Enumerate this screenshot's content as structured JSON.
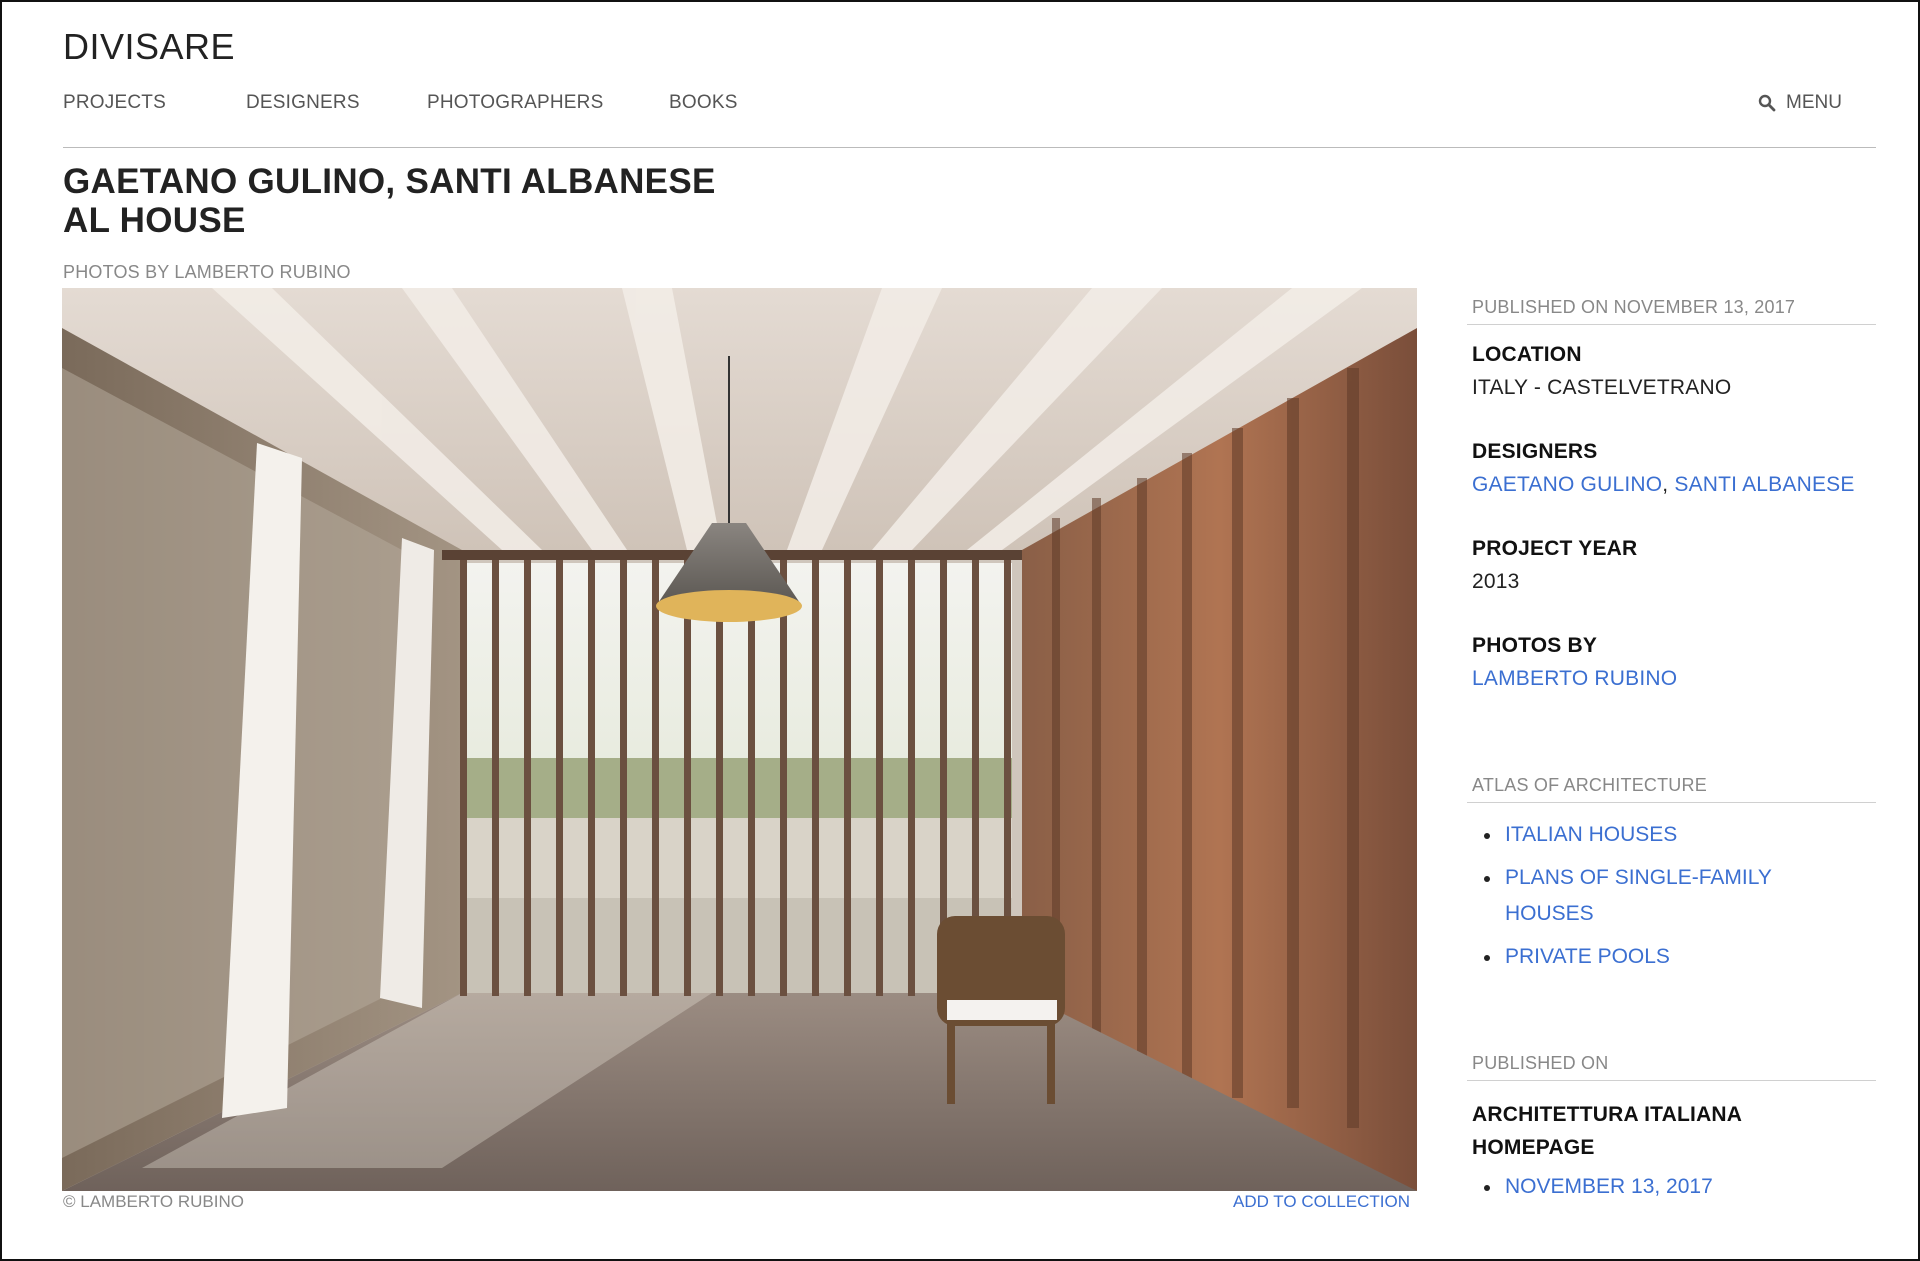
{
  "site": {
    "logo": "DIVISARE"
  },
  "nav": {
    "items": [
      "PROJECTS",
      "DESIGNERS",
      "PHOTOGRAPHERS",
      "BOOKS"
    ],
    "menu_label": "MENU"
  },
  "project": {
    "title_line1": "GAETANO GULINO, SANTI ALBANESE",
    "title_line2": "AL HOUSE",
    "photos_by_label": "PHOTOS BY LAMBERTO RUBINO"
  },
  "image": {
    "alt": "Interior of a room with wooden louvered walls, pendant lamp and wicker chair",
    "credit": "© LAMBERTO RUBINO",
    "add_to_collection": "ADD TO COLLECTION"
  },
  "sidebar": {
    "published_on": "PUBLISHED ON NOVEMBER 13, 2017",
    "location_label": "LOCATION",
    "location_value": "ITALY - CASTELVETRANO",
    "designers_label": "DESIGNERS",
    "designers": [
      "GAETANO GULINO",
      "SANTI ALBANESE"
    ],
    "designers_sep": ", ",
    "year_label": "PROJECT YEAR",
    "year_value": "2013",
    "photos_label": "PHOTOS BY",
    "photographer": "LAMBERTO RUBINO",
    "atlas_heading": "ATLAS OF ARCHITECTURE",
    "atlas_items": [
      "ITALIAN HOUSES",
      "PLANS OF SINGLE-FAMILY HOUSES",
      "PRIVATE POOLS"
    ],
    "published_heading": "PUBLISHED ON",
    "publication_line1": "ARCHITETTURA ITALIANA",
    "publication_line2": "HOMEPAGE",
    "publication_dates": [
      "NOVEMBER 13, 2017"
    ]
  },
  "colors": {
    "link": "#3b6fd1",
    "muted": "#888888",
    "text": "#222222"
  }
}
